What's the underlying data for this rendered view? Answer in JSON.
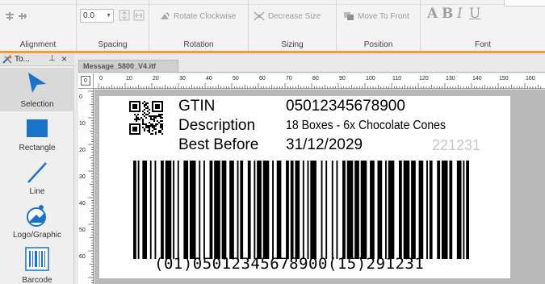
{
  "ribbon": {
    "groups": [
      {
        "label": "Alignment"
      },
      {
        "label": "Spacing"
      },
      {
        "label": "Rotation"
      },
      {
        "label": "Sizing"
      },
      {
        "label": "Position"
      },
      {
        "label": "Font"
      }
    ],
    "spacing_value": "0.0",
    "rotate_label": "Rotate Clockwise",
    "decrease_label": "Decrease Size",
    "move_front_label": "Move To Front",
    "font_buttons": {
      "bold": "A",
      "bold2": "B",
      "italic": "I",
      "underline": "U"
    }
  },
  "toolbox": {
    "title": "To...",
    "items": [
      {
        "label": "Selection"
      },
      {
        "label": "Rectangle"
      },
      {
        "label": "Line"
      },
      {
        "label": "Logo/Graphic"
      },
      {
        "label": "Barcode"
      }
    ]
  },
  "document": {
    "tab_title": "Message_5800_V4.itf",
    "ruler_h_labels": [
      "0",
      "10",
      "20",
      "30",
      "40",
      "50",
      "60",
      "70",
      "80",
      "90",
      "100",
      "110",
      "120",
      "130",
      "140",
      "150",
      "160"
    ],
    "ruler_v_labels": [
      "0",
      "10",
      "20",
      "30",
      "40",
      "50",
      "60"
    ],
    "ruler_corner": "0"
  },
  "label": {
    "gtin_label": "GTIN",
    "gtin_value": "05012345678900",
    "desc_label": "Description",
    "desc_value": "18 Boxes - 6x Chocolate Cones",
    "best_label": "Best Before",
    "best_value": "31/12/2029",
    "date_code": "221231",
    "barcode_text": "(01)05012345678900(15)291231"
  },
  "colors": {
    "accent_orange": "#f0a030",
    "tool_blue": "#1a73c7",
    "date_code_gray": "#c8c8c8"
  }
}
